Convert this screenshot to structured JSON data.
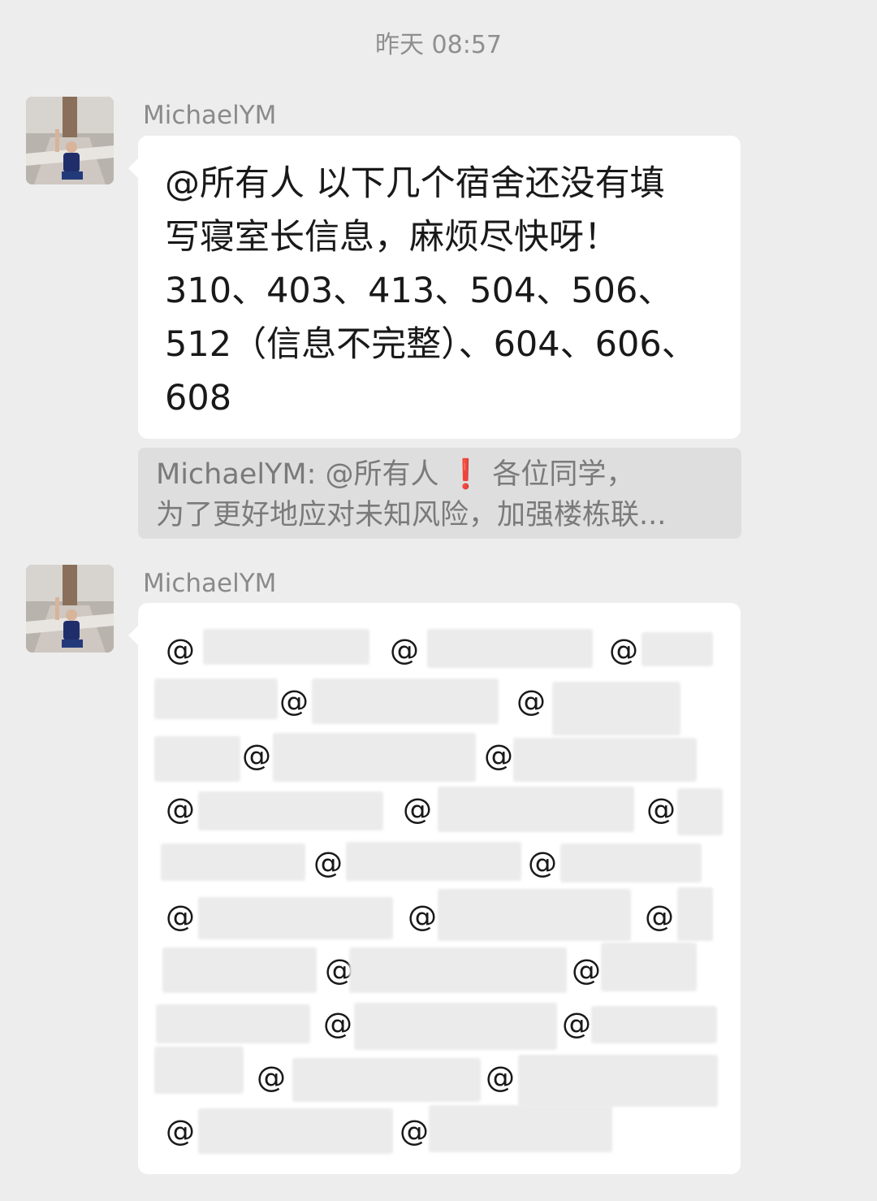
{
  "timestamp": "昨天 08:57",
  "messages": [
    {
      "sender": "MichaelYM",
      "lines": [
        "@所有人  以下几个宿舍还没有填",
        "写寝室长信息，麻烦尽快呀！",
        "310、403、413、504、506、",
        "512（信息不完整）、604、606、",
        "608"
      ]
    },
    {
      "sender": "MichaelYM",
      "mention_symbol": "@"
    }
  ],
  "quote": {
    "line1_prefix": "MichaelYM: @所有人 ",
    "line1_emoji": "❗",
    "line1_suffix": " 各位同学，",
    "line2": "为了更好地应对未知风险，加强楼栋联..."
  }
}
